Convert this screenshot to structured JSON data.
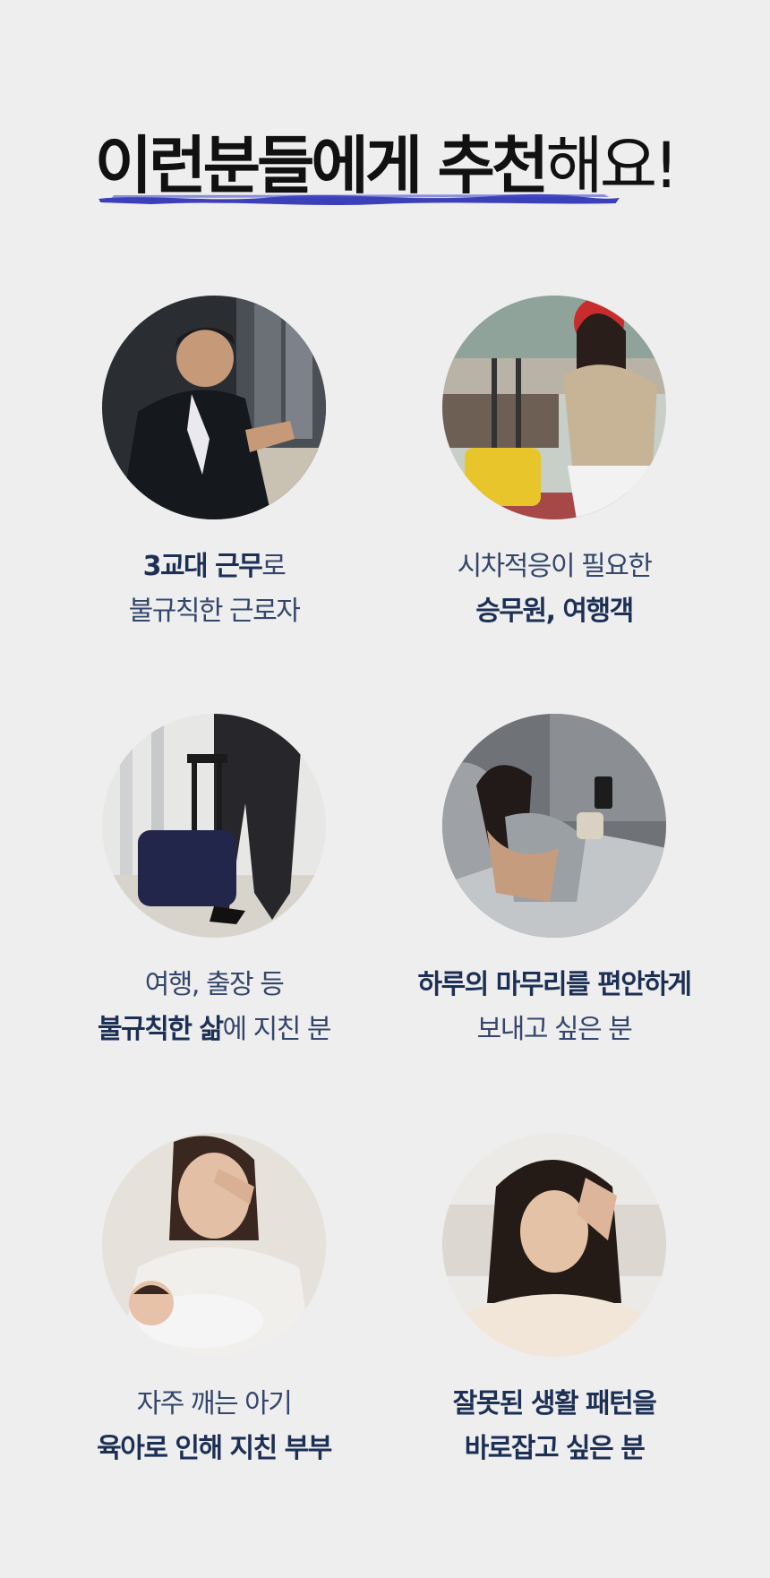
{
  "title": {
    "bold": "이런분들에게 추천",
    "rest": "해요!"
  },
  "accent_color": "#3b3fb8",
  "cards": [
    {
      "photo": "businessman-checking-watch-photo",
      "line1_bold": "3교대 근무",
      "line1_rest": "로",
      "line2": "불규칙한 근로자"
    },
    {
      "photo": "traveler-with-suitcase-photo",
      "line1": "시차적응이 필요한",
      "line2_bold": "승무원, 여행객"
    },
    {
      "photo": "walking-with-luggage-photo",
      "line1": "여행, 출장 등",
      "line2_bold": "불규칙한 삶",
      "line2_rest": "에 지친 분"
    },
    {
      "photo": "woman-in-bed-with-phone-photo",
      "line1_bold": "하루의 마무리를 편안하게",
      "line2": "보내고 싶은 분"
    },
    {
      "photo": "tired-mother-with-baby-photo",
      "line1": "자주 깨는 아기",
      "line2_bold": "육아로 인해 지친 부부"
    },
    {
      "photo": "tired-woman-holding-head-photo",
      "line1_bold": "잘못된 생활 패턴을",
      "line2_bold": "바로잡고 싶은 분"
    }
  ]
}
